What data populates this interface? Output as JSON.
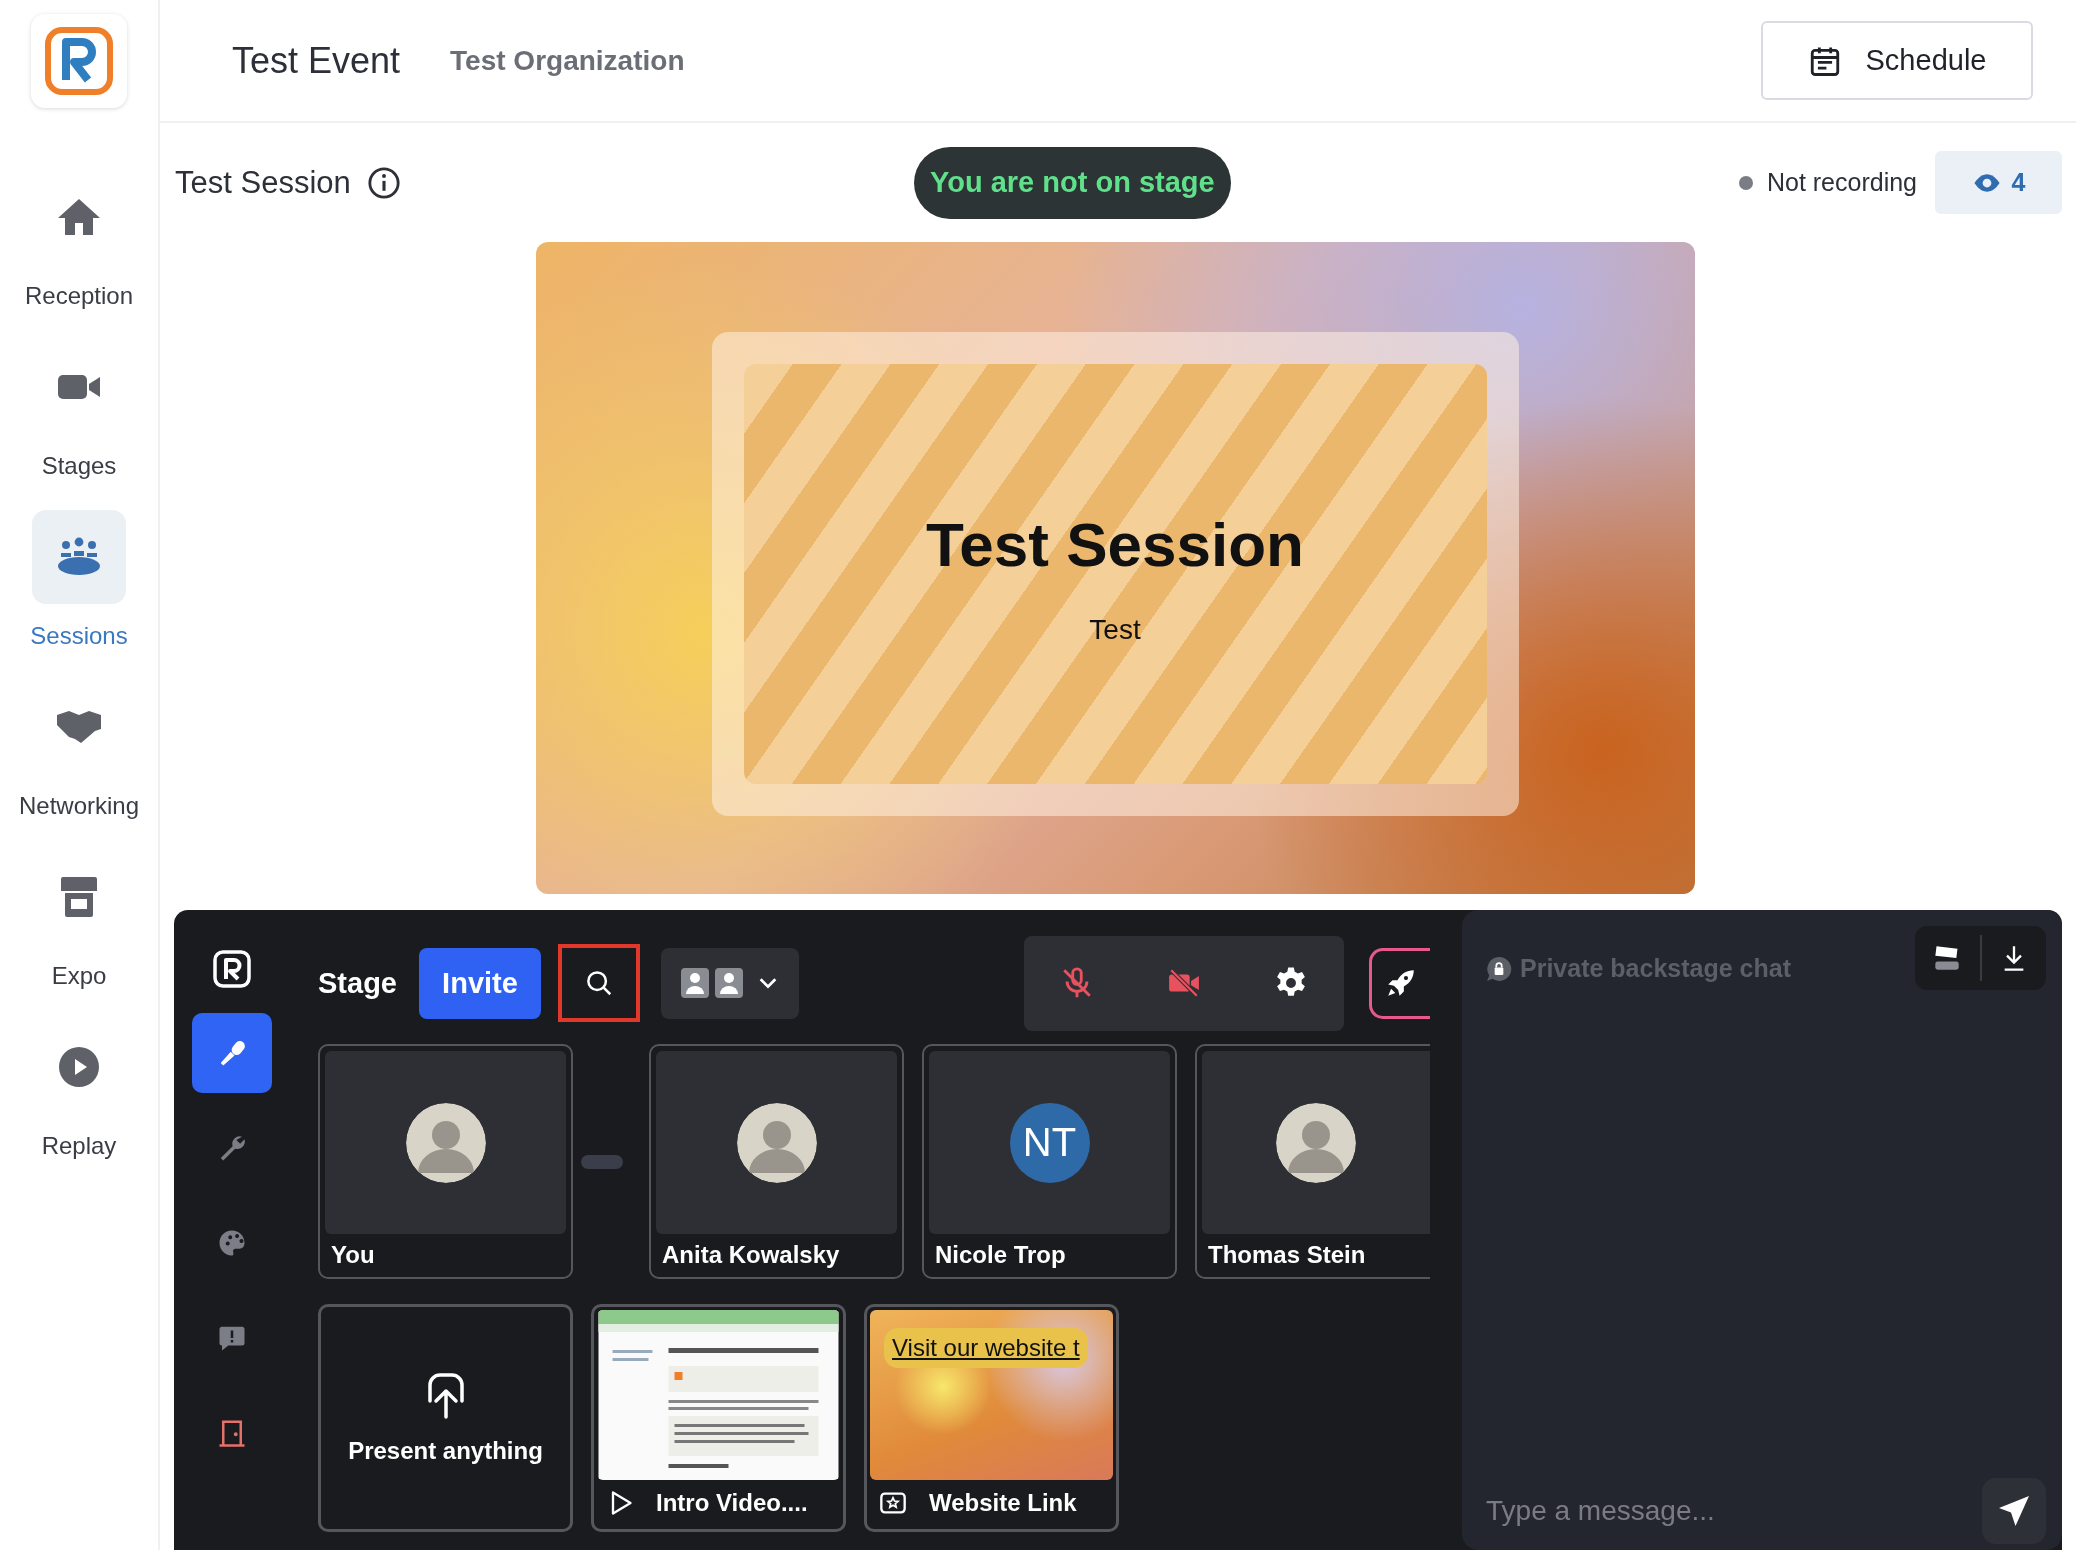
{
  "sidebar": {
    "items": [
      {
        "label": "Reception",
        "selected": false
      },
      {
        "label": "Stages",
        "selected": false
      },
      {
        "label": "Sessions",
        "selected": true
      },
      {
        "label": "Networking",
        "selected": false
      },
      {
        "label": "Expo",
        "selected": false
      },
      {
        "label": "Replay",
        "selected": false
      }
    ]
  },
  "header": {
    "event_title": "Test Event",
    "organization": "Test Organization",
    "schedule_button": "Schedule"
  },
  "session_bar": {
    "title": "Test Session",
    "stage_status": "You are not on stage",
    "recording": false,
    "recording_status": "Not recording",
    "viewer_count": "4"
  },
  "stage_banner": {
    "title": "Test Session",
    "subtitle": "Test"
  },
  "backstage": {
    "rail": [
      {
        "selected": true
      },
      {
        "selected": false
      },
      {
        "selected": false
      },
      {
        "selected": false
      },
      {
        "selected": false
      }
    ],
    "title": "Stage",
    "invite_button": "Invite",
    "search_highlighted": true,
    "mic_muted": true,
    "camera_off": true,
    "participants": [
      {
        "kind": "photo",
        "name": "You"
      },
      {
        "kind": "photo",
        "name": "Anita Kowalsky"
      },
      {
        "kind": "initials",
        "initials": "NT",
        "name": "Nicole Trop"
      },
      {
        "kind": "photo",
        "name": "Thomas Stein"
      }
    ],
    "media": [
      {
        "kind": "upload",
        "label": "Present anything"
      },
      {
        "kind": "video",
        "label": "Intro Video...."
      },
      {
        "kind": "link",
        "label": "Website Link",
        "overlay": "Visit our website t"
      }
    ]
  },
  "chat": {
    "title": "Private backstage chat",
    "placeholder": "Type a message..."
  }
}
